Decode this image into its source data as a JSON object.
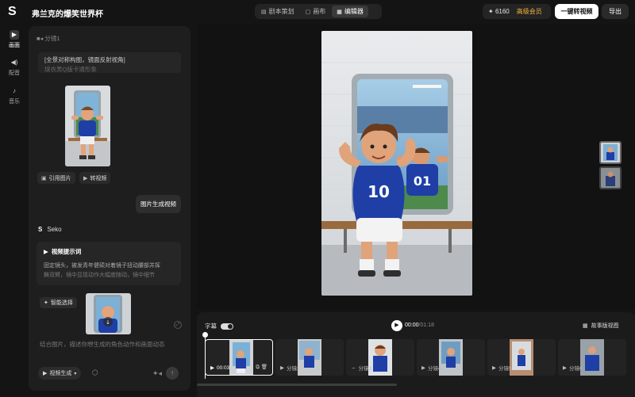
{
  "app": {
    "title": "弗兰克的爆笑世界杯"
  },
  "nav": {
    "tabs": [
      {
        "label": "剧本策划",
        "icon": "script-icon"
      },
      {
        "label": "画布",
        "icon": "canvas-icon"
      },
      {
        "label": "编辑器",
        "icon": "editor-icon",
        "active": true
      }
    ]
  },
  "account": {
    "credits": "6160",
    "vip": "高级会员"
  },
  "actions": {
    "convert": "一键转视频",
    "export": "导出"
  },
  "rail": [
    {
      "label": "画面",
      "icon": "video-icon",
      "active": true
    },
    {
      "label": "配音",
      "icon": "speaker-icon"
    },
    {
      "label": "音乐",
      "icon": "music-icon"
    }
  ],
  "panel": {
    "shot_label": "分镜1",
    "shot_text_line1": "[全景对称构图，镜面反射视角]",
    "shot_text_line2": "球衣男Q版卡通形象",
    "chips": {
      "reference": "引用图片",
      "to_video": "转视频"
    },
    "user_bubble": "图片生成视频",
    "assistant_name": "Seko",
    "card_title": "视频提示词",
    "card_body_line1": "固定镜头，被发青年健硕对着镜子扭动腰部并挥",
    "card_body_line2": "舞双臂，镜中显现动作大幅度随动，镜中细节",
    "smart_select": "智能选择",
    "prompt_placeholder": "结合图片，描述你想生成的角色动作和画面动态",
    "gen_mode": "视频生成"
  },
  "timeline": {
    "subtitle_label": "字幕",
    "current_time": "00:00",
    "total_time": "/01:18",
    "story_view": "故事版视图",
    "clips": [
      {
        "label": "00:03",
        "active": true
      },
      {
        "label": "分镜2"
      },
      {
        "label": "分镜3"
      },
      {
        "label": "分镜4"
      },
      {
        "label": "分镜5"
      },
      {
        "label": "分镜6"
      }
    ]
  },
  "colors": {
    "accent_vip": "#f0b33a",
    "jersey": "#1f3fa6"
  }
}
